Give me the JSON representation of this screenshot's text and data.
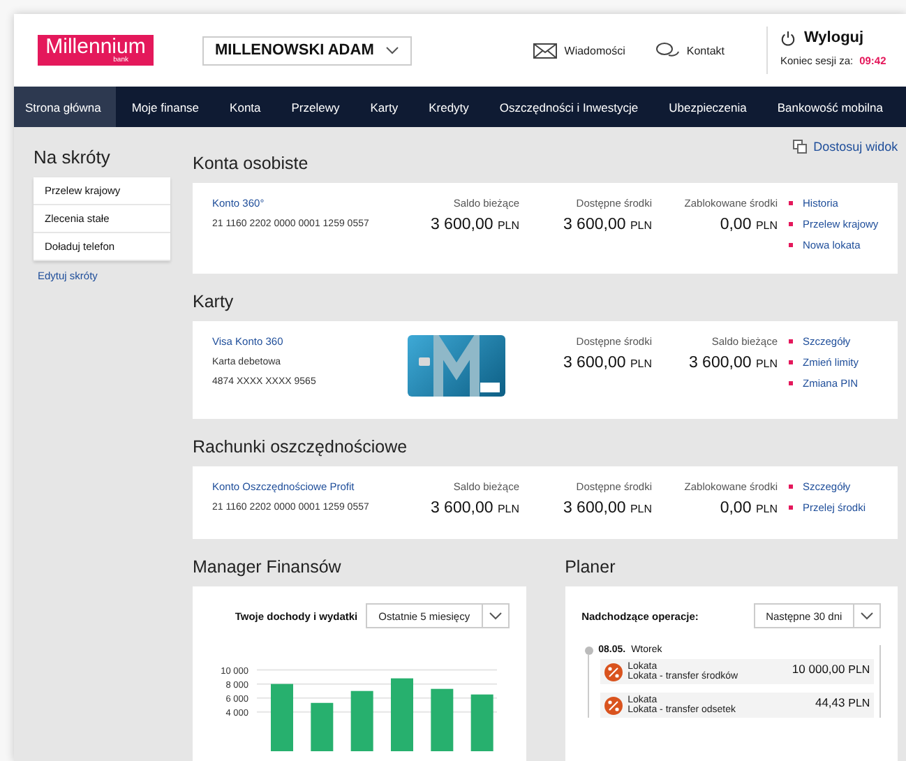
{
  "header": {
    "logo": "Millennium",
    "logo_sub": "bank",
    "user": "MILLENOWSKI ADAM",
    "links": [
      {
        "label": "Wiadomości",
        "kind": "mail"
      },
      {
        "label": "Kontakt",
        "kind": "chat"
      }
    ],
    "logout": "Wyloguj",
    "session_label": "Koniec sesji za:",
    "session_time": "09:42"
  },
  "nav": [
    {
      "label": "Strona główna",
      "selected": true
    },
    {
      "label": "Moje finanse",
      "selected": false
    },
    {
      "label": "Konta",
      "selected": false
    },
    {
      "label": "Przelewy",
      "selected": false
    },
    {
      "label": "Karty",
      "selected": false
    },
    {
      "label": "Kredyty",
      "selected": false
    },
    {
      "label": "Oszczędności i Inwestycje",
      "selected": false
    },
    {
      "label": "Ubezpieczenia",
      "selected": false
    },
    {
      "label": "Bankowość mobilna",
      "selected": false
    }
  ],
  "shortcuts": {
    "title": "Na skróty",
    "items": [
      "Przelew krajowy",
      "Zlecenia stałe",
      "Doładuj telefon"
    ],
    "edit": "Edytuj skróty"
  },
  "customize": "Dostosuj widok",
  "sections": [
    {
      "title": "Konta osobiste",
      "row": {
        "kind": "account",
        "name": "Konto 360°",
        "lines": [
          "21 1160 2202 0000 0001 1259 0557"
        ],
        "columns": [
          {
            "label": "Saldo bieżące",
            "amount": "3 600,00",
            "currency": "PLN"
          },
          {
            "label": "Dostępne środki",
            "amount": "3 600,00",
            "currency": "PLN"
          },
          {
            "label": "Zablokowane środki",
            "amount": "0,00",
            "currency": "PLN"
          }
        ],
        "links": [
          "Historia",
          "Przelew krajowy",
          "Nowa lokata"
        ]
      }
    },
    {
      "title": "Karty",
      "row": {
        "kind": "card",
        "name": "Visa Konto 360",
        "lines": [
          "Karta debetowa",
          "4874 XXXX XXXX 9565"
        ],
        "columns": [
          {
            "label": "Dostępne środki",
            "amount": "3 600,00",
            "currency": "PLN"
          },
          {
            "label": "Saldo bieżące",
            "amount": "3 600,00",
            "currency": "PLN"
          }
        ],
        "links": [
          "Szczegóły",
          "Zmień limity",
          "Zmiana PIN"
        ]
      }
    },
    {
      "title": "Rachunki oszczędnościowe",
      "row": {
        "kind": "account",
        "name": "Konto Oszczędnościowe Profit",
        "lines": [
          "21 1160 2202 0000 0001 1259 0557"
        ],
        "columns": [
          {
            "label": "Saldo bieżące",
            "amount": "3 600,00",
            "currency": "PLN"
          },
          {
            "label": "Dostępne środki",
            "amount": "3 600,00",
            "currency": "PLN"
          },
          {
            "label": "Zablokowane środki",
            "amount": "0,00",
            "currency": "PLN"
          }
        ],
        "links": [
          "Szczegóły",
          "Przelej środki"
        ]
      }
    }
  ],
  "finance": {
    "title": "Manager Finansów",
    "label": "Twoje dochody i wydatki",
    "select": "Ostatnie 5 miesięcy",
    "chart_data": {
      "type": "bar",
      "grid": true,
      "series": [
        {
          "color": "#27b06e",
          "values": [
            8000,
            5300,
            7000,
            8800,
            7300,
            6500
          ]
        }
      ],
      "ylim": [
        0,
        10000
      ],
      "yticks": [
        {
          "value": 4000,
          "label": "4 000"
        },
        {
          "value": 6000,
          "label": "6 000"
        },
        {
          "value": 8000,
          "label": "8 000"
        },
        {
          "value": 10000,
          "label": "10 000"
        }
      ]
    }
  },
  "planner": {
    "title": "Planer",
    "label": "Nadchodzące operacje:",
    "select": "Następne 30 dni",
    "days": [
      {
        "date": "08.05.",
        "weekday": "Wtorek",
        "operations": [
          {
            "title": "Lokata",
            "subtitle": "Lokata - transfer środków",
            "amount": "10 000,00",
            "currency": "PLN"
          },
          {
            "title": "Lokata",
            "subtitle": "Lokata - transfer odsetek",
            "amount": "44,43",
            "currency": "PLN"
          }
        ]
      }
    ]
  }
}
